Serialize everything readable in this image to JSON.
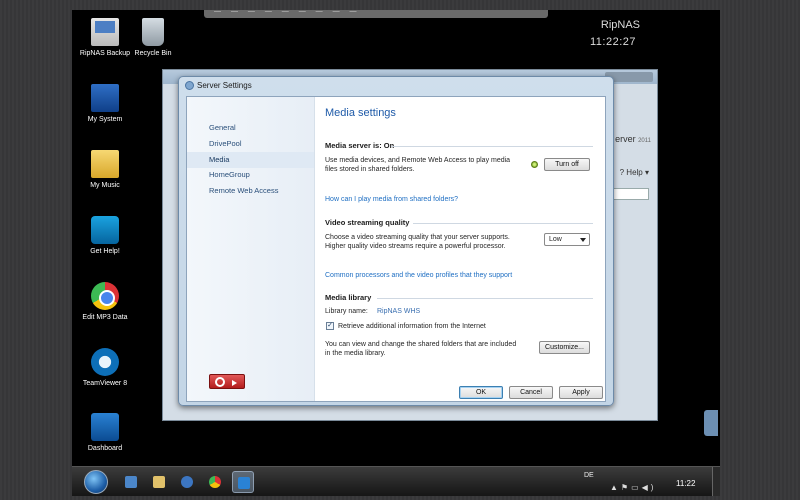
{
  "nas": {
    "name": "RipNAS",
    "time": "11:22:27"
  },
  "desktop_icons": [
    {
      "label": "RipNAS Backup",
      "icon": "backup-icon"
    },
    {
      "label": "Recycle Bin",
      "icon": "recycle-bin-icon"
    },
    {
      "label": "My System",
      "icon": "computer-icon"
    },
    {
      "label": "My Music",
      "icon": "music-folder-icon"
    },
    {
      "label": "Get Help!",
      "icon": "help-icon"
    },
    {
      "label": "Edit MP3 Data",
      "icon": "chrome-icon"
    },
    {
      "label": "TeamViewer 8",
      "icon": "teamviewer-icon"
    },
    {
      "label": "Dashboard",
      "icon": "dashboard-icon"
    }
  ],
  "background_window": {
    "product": "erver",
    "version": "2011",
    "help": "Help"
  },
  "dialog": {
    "title": "Server Settings",
    "nav": [
      "General",
      "DrivePool",
      "Media",
      "HomeGroup",
      "Remote Web Access"
    ],
    "selected_nav": "Media",
    "heading": "Media settings",
    "media_server": {
      "title": "Media server is: On",
      "desc_line1": "Use media devices, and Remote Web Access to play media",
      "desc_line2": "files stored in shared folders.",
      "button": "Turn off",
      "link": "How can I play media from shared folders?"
    },
    "video_quality": {
      "title": "Video streaming quality",
      "desc_line1": "Choose a video streaming quality that your server supports.",
      "desc_line2": "Higher quality video streams require a powerful processor.",
      "selected": "Low",
      "link": "Common processors and the video profiles that they support"
    },
    "media_library": {
      "title": "Media library",
      "name_label": "Library name:",
      "name_value": "RipNAS WHS",
      "checkbox_label": "Retrieve additional information from the Internet",
      "checkbox_checked": true,
      "desc_line1": "You can view and change the shared folders that are included",
      "desc_line2": "in the media library.",
      "button": "Customize..."
    },
    "ok": "OK",
    "cancel": "Cancel",
    "apply": "Apply"
  },
  "taskbar": {
    "language": "DE",
    "clock": "11:22"
  },
  "colors": {
    "link": "#1f6fc3",
    "heading": "#1e5aa8",
    "power": "#c62828"
  }
}
